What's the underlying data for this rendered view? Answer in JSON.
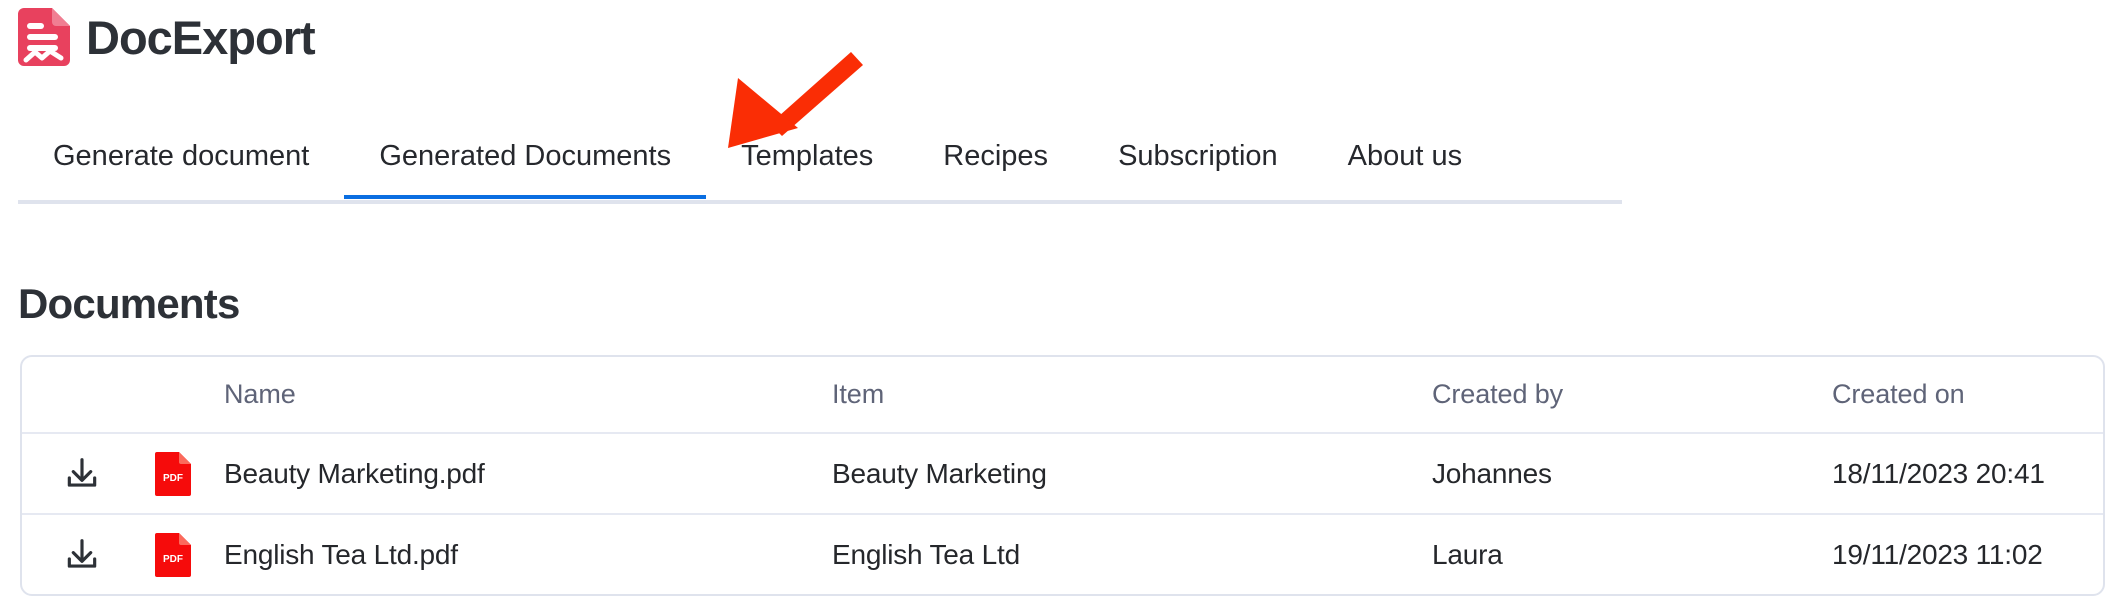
{
  "brand": {
    "name": "DocExport",
    "logo_icon": "document-chart-icon",
    "logo_color": "#e8415e"
  },
  "nav": {
    "active_index": 1,
    "accent_color": "#0a6ee1",
    "tabs": [
      {
        "label": "Generate document"
      },
      {
        "label": "Generated Documents"
      },
      {
        "label": "Templates"
      },
      {
        "label": "Recipes"
      },
      {
        "label": "Subscription"
      },
      {
        "label": "About us"
      }
    ]
  },
  "annotation": {
    "type": "arrow",
    "color": "#fa2d05",
    "points_to": "Generated Documents"
  },
  "main": {
    "title": "Documents",
    "table": {
      "columns": [
        "",
        "",
        "Name",
        "Item",
        "Created by",
        "Created on"
      ],
      "headers": {
        "name": "Name",
        "item": "Item",
        "created_by": "Created by",
        "created_on": "Created on"
      },
      "rows": [
        {
          "download_icon": "download-icon",
          "file_icon": "pdf-file-icon",
          "file_badge": "PDF",
          "name": "Beauty Marketing.pdf",
          "item": "Beauty Marketing",
          "created_by": "Johannes",
          "created_on": "18/11/2023 20:41"
        },
        {
          "download_icon": "download-icon",
          "file_icon": "pdf-file-icon",
          "file_badge": "PDF",
          "name": "English Tea Ltd.pdf",
          "item": "English Tea Ltd",
          "created_by": "Laura",
          "created_on": "19/11/2023 11:02"
        }
      ]
    }
  }
}
